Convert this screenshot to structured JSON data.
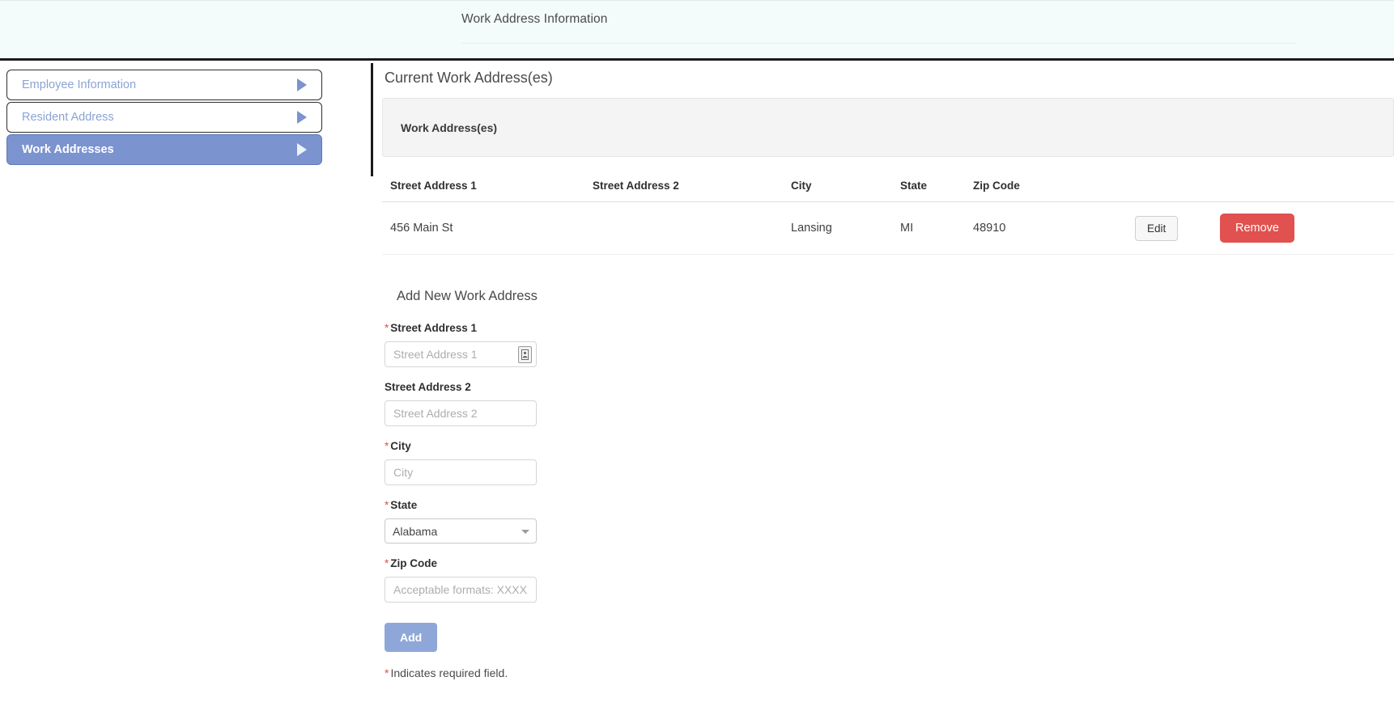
{
  "header": {
    "title": "Work Address Information"
  },
  "sidebar": {
    "items": [
      {
        "label": "Employee Information",
        "active": false
      },
      {
        "label": "Resident Address",
        "active": false
      },
      {
        "label": "Work Addresses",
        "active": true
      }
    ]
  },
  "main": {
    "section_title": "Current Work Address(es)",
    "panel_header": "Work Address(es)",
    "table": {
      "columns": [
        "Street Address 1",
        "Street Address 2",
        "City",
        "State",
        "Zip Code"
      ],
      "rows": [
        {
          "street_address_1": "456 Main St",
          "street_address_2": "",
          "city": "Lansing",
          "state": "MI",
          "zip_code": "48910",
          "edit_label": "Edit",
          "remove_label": "Remove"
        }
      ]
    },
    "form": {
      "title": "Add New Work Address",
      "fields": {
        "street1": {
          "label": "Street Address 1",
          "placeholder": "Street Address 1",
          "value": "",
          "required": true
        },
        "street2": {
          "label": "Street Address 2",
          "placeholder": "Street Address 2",
          "value": "",
          "required": false
        },
        "city": {
          "label": "City",
          "placeholder": "City",
          "value": "",
          "required": true
        },
        "state": {
          "label": "State",
          "selected": "Alabama",
          "required": true
        },
        "zip": {
          "label": "Zip Code",
          "placeholder": "Acceptable formats: XXXXX or XXXXX-XXXX",
          "value": "",
          "required": true
        }
      },
      "add_label": "Add",
      "required_note": "Indicates required field.",
      "required_marker": "*"
    }
  },
  "colors": {
    "header_bg": "#f3fcfb",
    "accent_blue": "#7b93ce",
    "nav_text_blue": "#8ba3d4",
    "remove_red": "#e0514f",
    "add_blue": "#8fa7d8",
    "required_red": "#d9534f",
    "panel_gray": "#f4f4f4"
  }
}
